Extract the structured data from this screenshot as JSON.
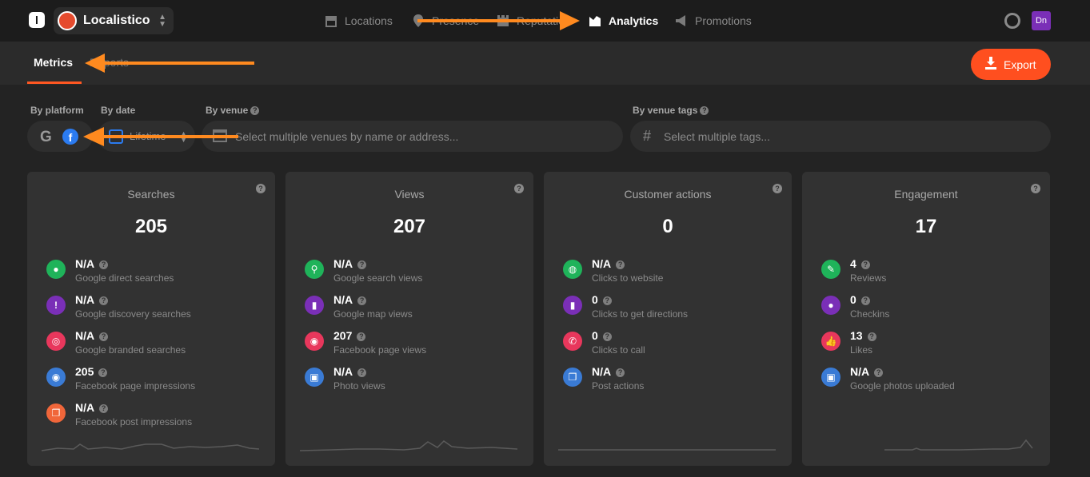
{
  "app": {
    "logo_letter": "l",
    "venue_name": "Localistico",
    "user_initials": "Dn"
  },
  "nav": [
    {
      "label": "Locations",
      "icon": "store-icon",
      "active": false
    },
    {
      "label": "Presence",
      "icon": "map-pin-icon",
      "active": false
    },
    {
      "label": "Reputation",
      "icon": "castle-icon",
      "active": false
    },
    {
      "label": "Analytics",
      "icon": "analytics-icon",
      "active": true
    },
    {
      "label": "Promotions",
      "icon": "megaphone-icon",
      "active": false
    }
  ],
  "tabs": {
    "metrics": "Metrics",
    "reports": "Reports"
  },
  "export_label": "Export",
  "filters": {
    "platform_label": "By platform",
    "date_label": "By date",
    "date_value": "Lifetime",
    "venue_label": "By venue",
    "venue_placeholder": "Select multiple venues by name or address...",
    "tags_label": "By venue tags",
    "tags_placeholder": "Select multiple tags..."
  },
  "cards": [
    {
      "title": "Searches",
      "total": "205",
      "metrics": [
        {
          "value": "N/A",
          "label": "Google direct searches",
          "icon": "pin-icon",
          "color": "#1fb35a"
        },
        {
          "value": "N/A",
          "label": "Google discovery searches",
          "icon": "badge-icon",
          "color": "#7a2fb7"
        },
        {
          "value": "N/A",
          "label": "Google branded searches",
          "icon": "target-icon",
          "color": "#e8375c"
        },
        {
          "value": "205",
          "label": "Facebook page impressions",
          "icon": "eye-icon",
          "color": "#3a7bd5"
        },
        {
          "value": "N/A",
          "label": "Facebook post impressions",
          "icon": "layers-icon",
          "color": "#f0663a"
        }
      ]
    },
    {
      "title": "Views",
      "total": "207",
      "metrics": [
        {
          "value": "N/A",
          "label": "Google search views",
          "icon": "search-icon",
          "color": "#1fb35a"
        },
        {
          "value": "N/A",
          "label": "Google map views",
          "icon": "map-icon",
          "color": "#7a2fb7"
        },
        {
          "value": "207",
          "label": "Facebook page views",
          "icon": "eye-icon",
          "color": "#e8375c"
        },
        {
          "value": "N/A",
          "label": "Photo views",
          "icon": "image-icon",
          "color": "#3a7bd5"
        }
      ]
    },
    {
      "title": "Customer actions",
      "total": "0",
      "metrics": [
        {
          "value": "N/A",
          "label": "Clicks to website",
          "icon": "globe-icon",
          "color": "#1fb35a"
        },
        {
          "value": "0",
          "label": "Clicks to get directions",
          "icon": "map-icon",
          "color": "#7a2fb7"
        },
        {
          "value": "0",
          "label": "Clicks to call",
          "icon": "phone-icon",
          "color": "#e8375c"
        },
        {
          "value": "N/A",
          "label": "Post actions",
          "icon": "layers-icon",
          "color": "#3a7bd5"
        }
      ]
    },
    {
      "title": "Engagement",
      "total": "17",
      "metrics": [
        {
          "value": "4",
          "label": "Reviews",
          "icon": "review-icon",
          "color": "#1fb35a"
        },
        {
          "value": "0",
          "label": "Checkins",
          "icon": "pin-icon",
          "color": "#7a2fb7"
        },
        {
          "value": "13",
          "label": "Likes",
          "icon": "thumbs-up-icon",
          "color": "#e8375c"
        },
        {
          "value": "N/A",
          "label": "Google photos uploaded",
          "icon": "image-icon",
          "color": "#3a7bd5"
        }
      ]
    }
  ],
  "accent_color": "#ff4f1f",
  "annotation_color": "#ff8a1f"
}
